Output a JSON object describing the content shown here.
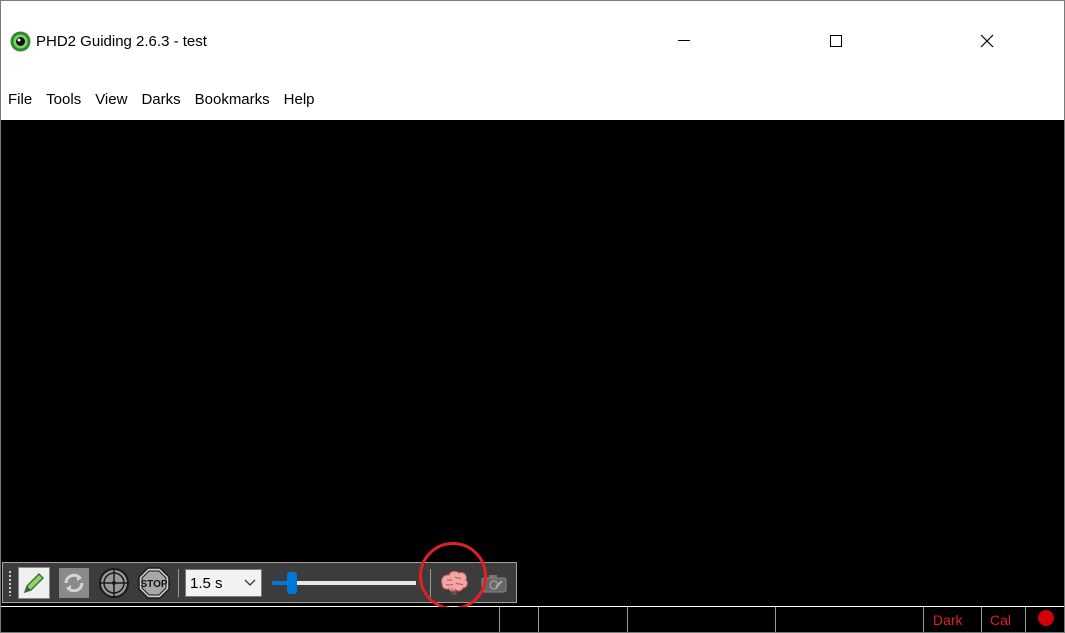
{
  "window": {
    "title": "PHD2 Guiding 2.6.3 - test",
    "controls": [
      "minimize-icon",
      "maximize-icon",
      "close-icon"
    ]
  },
  "menu": {
    "items": [
      "File",
      "Tools",
      "View",
      "Darks",
      "Bookmarks",
      "Help"
    ]
  },
  "toolbar": {
    "buttons": [
      "connect-equipment-icon",
      "loop-exposures-icon",
      "guide-crosshair-icon",
      "stop-icon"
    ],
    "stop_label": "STOP",
    "exposure": {
      "selected": "1.5 s"
    },
    "gamma_slider": {
      "value_fraction": 0.14
    },
    "brain_button": "brain-icon",
    "camera_button": "camera-settings-icon"
  },
  "statusbar": {
    "dark_label": "Dark",
    "cal_label": "Cal",
    "indicator": "red-dot-icon"
  },
  "colors": {
    "status_red": "#e01f26",
    "annotation_red": "#e01f26",
    "slider_blue": "#0078d7",
    "canvas": "#000000"
  }
}
